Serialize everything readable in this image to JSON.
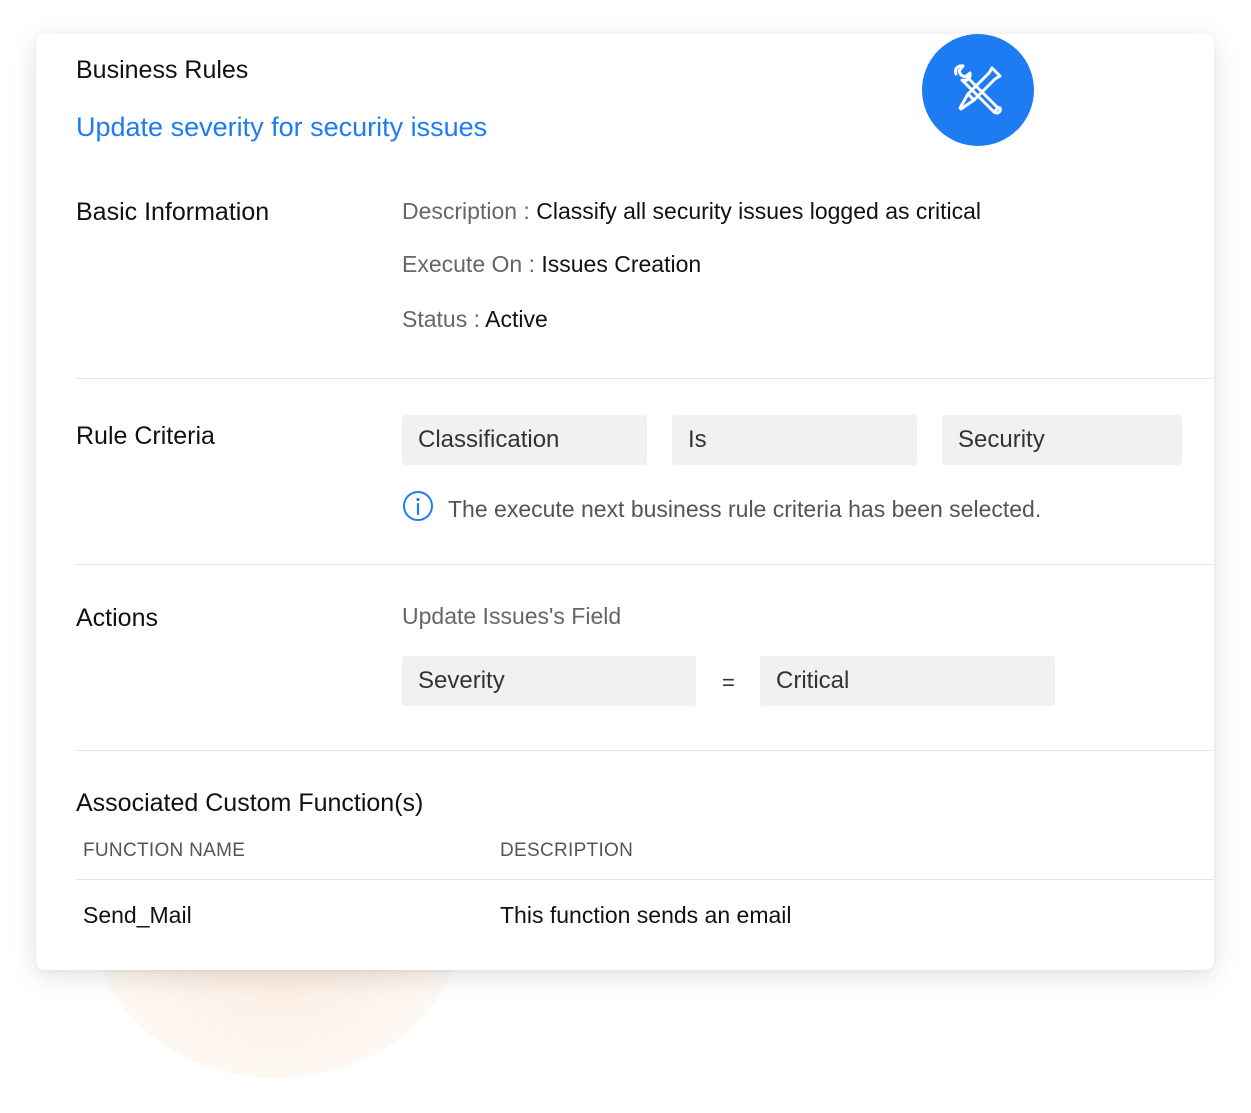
{
  "header": {
    "title": "Business Rules",
    "rule_name": "Update severity for security issues"
  },
  "icons": {
    "badge": "wrench-screwdriver-icon",
    "info": "info-icon"
  },
  "colors": {
    "accent": "#1e7cf2"
  },
  "basic_information": {
    "label": "Basic Information",
    "description_key": "Description :",
    "description_value": "Classify all security issues logged as critical",
    "execute_on_key": "Execute On :",
    "execute_on_value": "Issues Creation",
    "status_key": "Status :",
    "status_value": "Active"
  },
  "rule_criteria": {
    "label": "Rule Criteria",
    "field": "Classification",
    "operator": "Is",
    "value": "Security",
    "info_text": "The execute next business rule criteria has been selected."
  },
  "actions": {
    "label": "Actions",
    "action_title": "Update Issues's Field",
    "field": "Severity",
    "equals": "=",
    "value": "Critical"
  },
  "custom_functions": {
    "label": "Associated Custom Function(s)",
    "columns": [
      "FUNCTION NAME",
      "DESCRIPTION"
    ],
    "rows": [
      {
        "name": "Send_Mail",
        "description": "This function sends an email"
      }
    ]
  }
}
